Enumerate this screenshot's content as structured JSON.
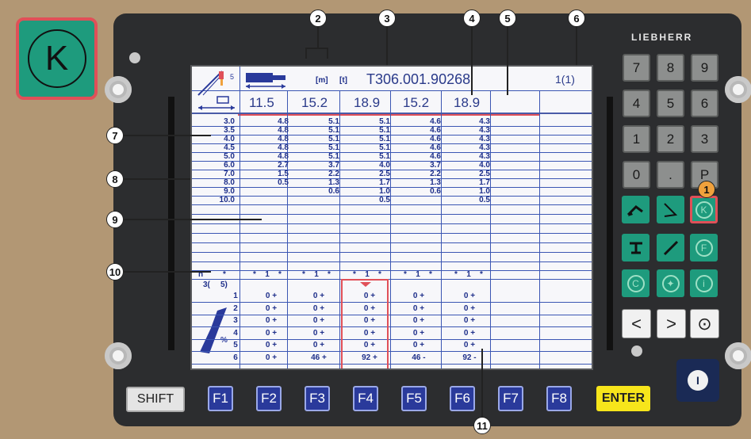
{
  "brand": "LIEBHERR",
  "callout_k_label": "K",
  "header": {
    "unit_m": "[m]",
    "unit_t": "[t]",
    "table_code": "T306.001.90268",
    "page": "1(1)"
  },
  "boom_lengths": [
    "11.5",
    "15.2",
    "18.9",
    "15.2",
    "18.9"
  ],
  "radii": [
    "3.0",
    "3.5",
    "4.0",
    "4.5",
    "5.0",
    "6.0",
    "7.0",
    "8.0",
    "9.0",
    "10.0"
  ],
  "load_rows": [
    [
      "4.8",
      "5.1",
      "5.1",
      "4.6",
      "4.3"
    ],
    [
      "4.8",
      "5.1",
      "5.1",
      "4.6",
      "4.3"
    ],
    [
      "4.8",
      "5.1",
      "5.1",
      "4.6",
      "4.3"
    ],
    [
      "4.8",
      "5.1",
      "5.1",
      "4.6",
      "4.3"
    ],
    [
      "4.8",
      "5.1",
      "5.1",
      "4.6",
      "4.3"
    ],
    [
      "2.7",
      "3.7",
      "4.0",
      "3.7",
      "4.0"
    ],
    [
      "1.5",
      "2.2",
      "2.5",
      "2.2",
      "2.5"
    ],
    [
      "0.5",
      "1.3",
      "1.7",
      "1.3",
      "1.7"
    ],
    [
      "",
      "0.6",
      "1.0",
      "0.6",
      "1.0"
    ],
    [
      "",
      "",
      "0.5",
      "",
      "0.5"
    ]
  ],
  "reeving": {
    "label_n": "n",
    "marker": "*",
    "values": [
      "1",
      "1",
      "1",
      "1",
      "1"
    ],
    "section": "3(",
    "section_count": "5)"
  },
  "telescope": {
    "percent": "%",
    "sections": [
      "1",
      "2",
      "3",
      "4",
      "5",
      "6"
    ],
    "rows": [
      [
        "0 +",
        "0 +",
        "0 +",
        "0 +",
        "0 +"
      ],
      [
        "0 +",
        "0 +",
        "0 +",
        "0 +",
        "0 +"
      ],
      [
        "0 +",
        "0 +",
        "0 +",
        "0 +",
        "0 +"
      ],
      [
        "0 +",
        "0 +",
        "0 +",
        "0 +",
        "0 +"
      ],
      [
        "0 +",
        "0 +",
        "0 +",
        "0 +",
        "0 +"
      ],
      [
        "0 +",
        "46 +",
        "92 +",
        "46 -",
        "92 -"
      ]
    ]
  },
  "callouts": [
    "1",
    "2",
    "3",
    "4",
    "5",
    "6",
    "7",
    "8",
    "9",
    "10",
    "11"
  ],
  "keypad": [
    "7",
    "8",
    "9",
    "4",
    "5",
    "6",
    "1",
    "2",
    "3",
    "0",
    ".",
    "P"
  ],
  "green_keys": {
    "k": "K",
    "f": "F",
    "c": "C",
    "i": "i"
  },
  "nav": {
    "left": "<",
    "right": ">",
    "ok": "⊙"
  },
  "power_label": "I",
  "bottom_keys": {
    "shift": "SHIFT",
    "f_keys": [
      "F1",
      "F2",
      "F3",
      "F4",
      "F5",
      "F6",
      "F7",
      "F8"
    ],
    "enter": "ENTER"
  },
  "colors": {
    "background": "#b29774",
    "console": "#2c2d2f",
    "screen_blue": "#3b56b3",
    "highlight_red": "#e05058",
    "green_key": "#1e9b7d",
    "f_key": "#2a3a9b",
    "enter_key": "#f7e51b"
  }
}
